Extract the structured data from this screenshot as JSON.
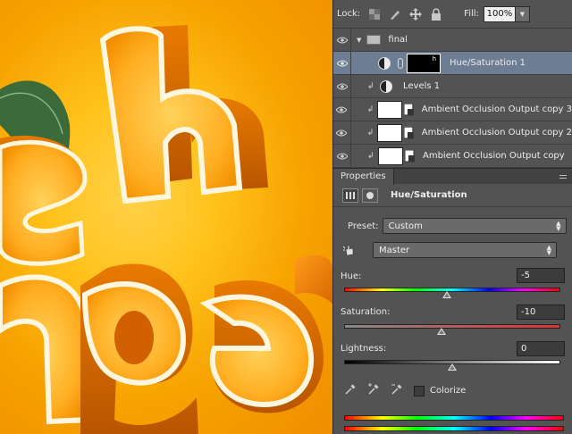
{
  "layers_panel": {
    "lock_label": "Lock:",
    "fill_label": "Fill:",
    "fill_value": "100%",
    "layers": [
      {
        "name": "final",
        "kind": "group",
        "selected": false
      },
      {
        "name": "Hue/Saturation 1",
        "kind": "adjustment-mask",
        "selected": true
      },
      {
        "name": "Levels 1",
        "kind": "adjustment",
        "selected": false
      },
      {
        "name": "Ambient Occlusion Output copy 3",
        "kind": "smart-object",
        "selected": false
      },
      {
        "name": "Ambient Occlusion Output copy 2",
        "kind": "smart-object",
        "selected": false
      },
      {
        "name": "Ambient Occlusion Output copy",
        "kind": "smart-object",
        "selected": false
      }
    ]
  },
  "properties": {
    "tab_label": "Properties",
    "title": "Hue/Saturation",
    "preset_label": "Preset:",
    "preset_value": "Custom",
    "channel_value": "Master",
    "hue_label": "Hue:",
    "hue_value": "-5",
    "saturation_label": "Saturation:",
    "saturation_value": "-10",
    "lightness_label": "Lightness:",
    "lightness_value": "0",
    "colorize_label": "Colorize",
    "colorize_checked": false
  },
  "colors": {
    "selected_layer": "#6d7d93",
    "panel_bg": "#535353",
    "artwork_orange": "#f7a300"
  }
}
